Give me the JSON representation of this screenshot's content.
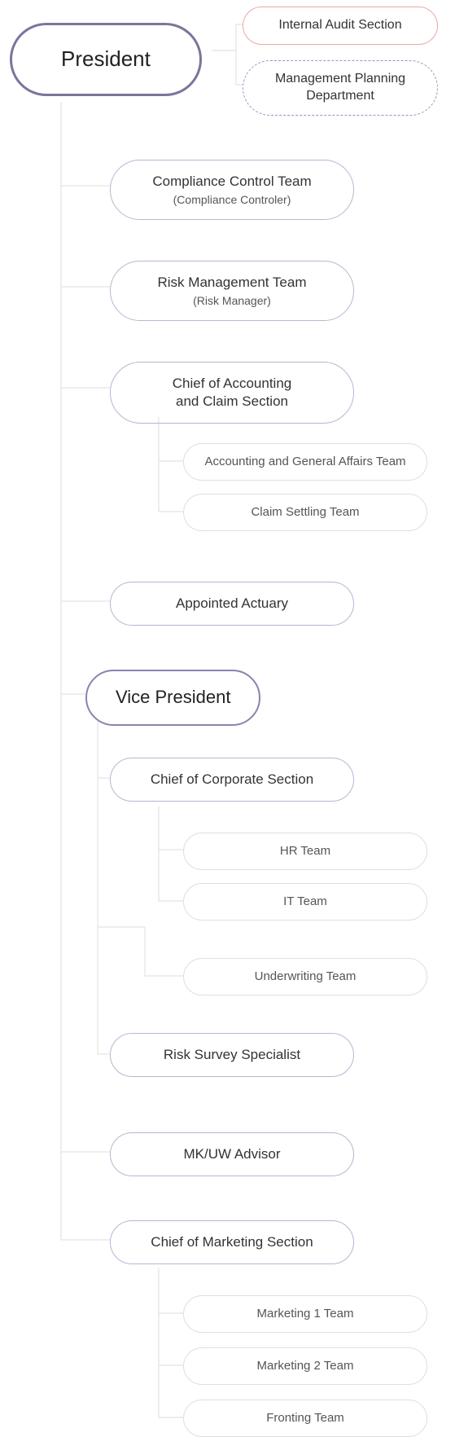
{
  "president": "President",
  "internal_audit": "Internal Audit Section",
  "mgmt_planning": "Management Planning Department",
  "compliance": {
    "title": "Compliance Control Team",
    "sub": "(Compliance Controler)"
  },
  "risk_mgmt": {
    "title": "Risk Management Team",
    "sub": "(Risk Manager)"
  },
  "accounting_chief": {
    "line1": "Chief of Accounting",
    "line2": "and Claim Section"
  },
  "accounting_team": "Accounting and General Affairs Team",
  "claim_team": "Claim Settling Team",
  "actuary": "Appointed Actuary",
  "vp": "Vice President",
  "corp_chief": "Chief of Corporate Section",
  "hr_team": "HR Team",
  "it_team": "IT Team",
  "underwriting": "Underwriting Team",
  "risk_survey": "Risk Survey Specialist",
  "mkuw": "MK/UW Advisor",
  "marketing_chief": "Chief of Marketing Section",
  "marketing1": "Marketing 1 Team",
  "marketing2": "Marketing 2 Team",
  "fronting": "Fronting Team"
}
